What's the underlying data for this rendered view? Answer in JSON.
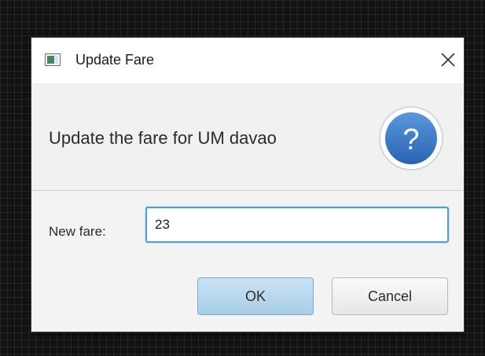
{
  "window": {
    "title": "Update Fare",
    "app_icon": "javafx-window-icon",
    "close_icon": "close-icon"
  },
  "header": {
    "text": "Update the fare for UM davao",
    "icon": "question-icon"
  },
  "form": {
    "label": "New fare:",
    "value": "23"
  },
  "buttons": {
    "ok_label": "OK",
    "cancel_label": "Cancel"
  },
  "colors": {
    "accent": "#3a78c8",
    "focus_border": "#4aa0dc",
    "ok_button": "#b8d8ef"
  }
}
